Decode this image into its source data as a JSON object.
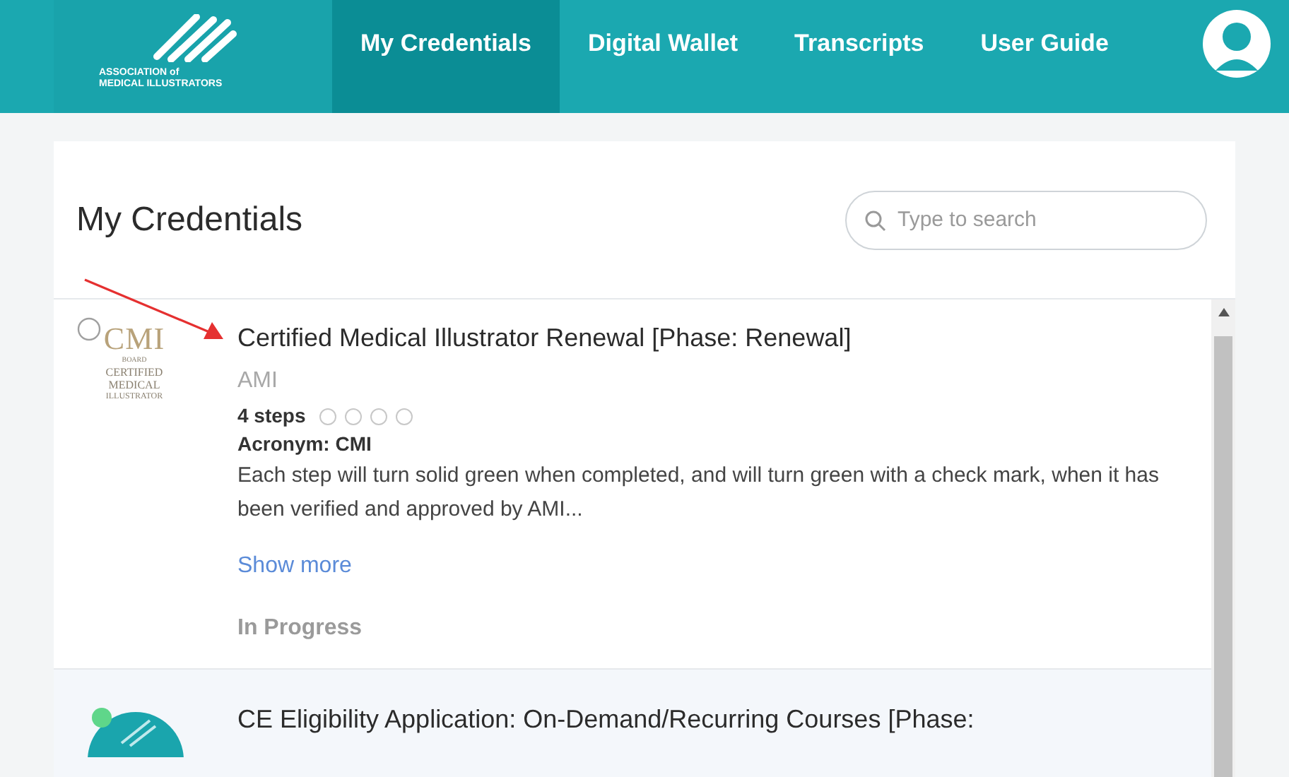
{
  "header": {
    "logo": {
      "line_1": "ASSOCIATION of",
      "line_2": "MEDICAL ILLUSTRATORS"
    },
    "nav": [
      {
        "label": "My Credentials",
        "selected": true
      },
      {
        "label": "Digital Wallet",
        "selected": false
      },
      {
        "label": "Transcripts",
        "selected": false
      },
      {
        "label": "User Guide",
        "selected": false
      }
    ]
  },
  "page": {
    "title": "My Credentials",
    "search": {
      "placeholder": "Type to search"
    }
  },
  "credentials": [
    {
      "kind": "cmi",
      "logo": {
        "mark": "CMI",
        "board": "BOARD",
        "line_1": "CERTIFIED",
        "line_2": "MEDICAL",
        "line_3": "ILLUSTRATOR"
      },
      "title": "Certified Medical Illustrator Renewal [Phase: Renewal]",
      "issuer": "AMI",
      "steps_label": "4 steps",
      "steps": [
        {
          "completed": false
        },
        {
          "completed": false
        },
        {
          "completed": false
        },
        {
          "completed": false
        }
      ],
      "acronym": "Acronym: CMI",
      "description": "Each step will turn solid green when completed, and will turn green with a check mark, when it has been verified and approved by AMI...",
      "show_more": "Show more",
      "status": "In Progress"
    },
    {
      "kind": "ce",
      "title": "CE Eligibility Application: On-Demand/Recurring Courses [Phase:"
    }
  ]
}
